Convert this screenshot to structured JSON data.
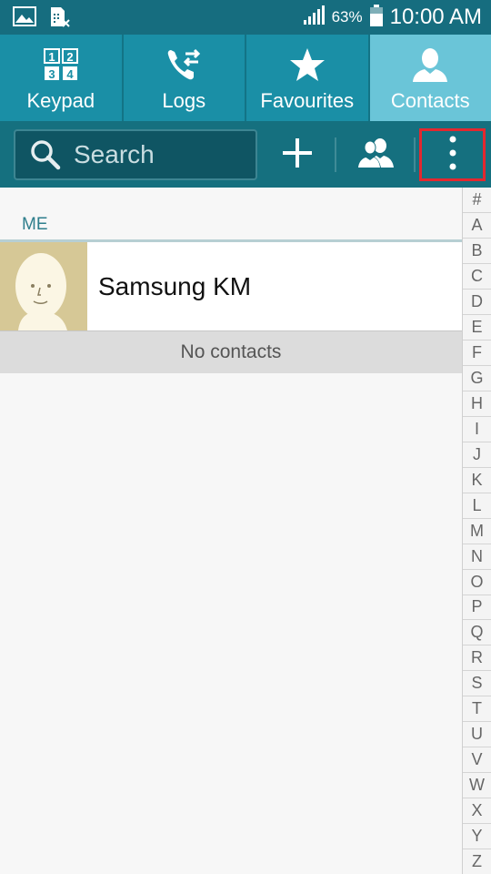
{
  "status_bar": {
    "battery_percent": "63%",
    "time": "10:00 AM",
    "icons": [
      "gallery-icon",
      "sim-icon",
      "signal-icon",
      "battery-icon"
    ]
  },
  "tabs": [
    {
      "label": "Keypad",
      "icon": "keypad-icon",
      "active": false
    },
    {
      "label": "Logs",
      "icon": "logs-icon",
      "active": false
    },
    {
      "label": "Favourites",
      "icon": "star-icon",
      "active": false
    },
    {
      "label": "Contacts",
      "icon": "contact-icon",
      "active": true
    }
  ],
  "action_bar": {
    "search_placeholder": "Search",
    "buttons": [
      "add-contact-icon",
      "groups-icon",
      "more-options-icon"
    ]
  },
  "contacts": {
    "section_label": "ME",
    "me_name": "Samsung KM",
    "empty_message": "No contacts"
  },
  "index": [
    "#",
    "A",
    "B",
    "C",
    "D",
    "E",
    "F",
    "G",
    "H",
    "I",
    "J",
    "K",
    "L",
    "M",
    "N",
    "O",
    "P",
    "Q",
    "R",
    "S",
    "T",
    "U",
    "V",
    "W",
    "X",
    "Y",
    "Z"
  ],
  "colors": {
    "status_bar": "#166d7f",
    "tab_bg": "#1a8fa6",
    "tab_active": "#6ac5d8",
    "action_bar": "#15707f",
    "highlight": "#e3282f"
  }
}
